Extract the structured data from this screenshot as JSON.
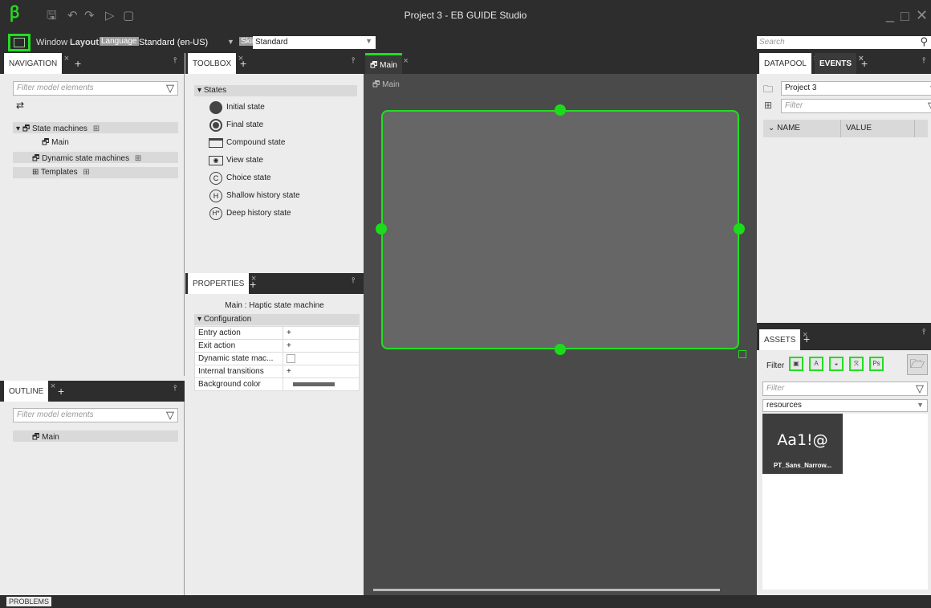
{
  "app": {
    "title": "Project 3 - EB GUIDE Studio"
  },
  "toolbar": {
    "window_label": "Window",
    "layout_label": "Layout",
    "language_tag": "Language",
    "language_value": "Standard (en-US)",
    "skin_tag": "Skin",
    "skin_value": "Standard",
    "search_placeholder": "Search"
  },
  "navigation": {
    "tab_label": "NAVIGATION",
    "filter_placeholder": "Filter model elements",
    "items": [
      {
        "label": "State machines"
      },
      {
        "label": "Main"
      },
      {
        "label": "Dynamic state machines"
      },
      {
        "label": "Templates"
      }
    ]
  },
  "toolbox": {
    "tab_label": "TOOLBOX",
    "section": "States",
    "items": [
      {
        "label": "Initial state",
        "icon": "initial-state-icon"
      },
      {
        "label": "Final state",
        "icon": "final-state-icon"
      },
      {
        "label": "Compound state",
        "icon": "compound-state-icon"
      },
      {
        "label": "View state",
        "icon": "view-state-icon"
      },
      {
        "label": "Choice state",
        "icon": "choice-state-icon"
      },
      {
        "label": "Shallow history state",
        "icon": "shallow-history-icon"
      },
      {
        "label": "Deep history state",
        "icon": "deep-history-icon"
      }
    ]
  },
  "properties": {
    "tab_label": "PROPERTIES",
    "subject": "Main : Haptic state machine",
    "section": "Configuration",
    "rows": [
      {
        "name": "Entry action",
        "value": "+"
      },
      {
        "name": "Exit action",
        "value": "+"
      },
      {
        "name": "Dynamic state mac...",
        "value": ""
      },
      {
        "name": "Internal transitions",
        "value": "+"
      },
      {
        "name": "Background color",
        "value": ""
      }
    ]
  },
  "outline": {
    "tab_label": "OUTLINE",
    "filter_placeholder": "Filter model elements",
    "items": [
      {
        "label": "Main"
      }
    ]
  },
  "editor": {
    "tab_label": "Main",
    "breadcrumb": "Main"
  },
  "datapool": {
    "tab_datapool": "DATAPOOL",
    "tab_events": "EVENTS",
    "project_value": "Project 3",
    "filter_placeholder": "Filter",
    "col_name": "NAME",
    "col_value": "VALUE"
  },
  "assets": {
    "tab_label": "ASSETS",
    "filter_label": "Filter",
    "filter_placeholder": "Filter",
    "folder_value": "resources",
    "card_preview": "Aa1!@",
    "card_name": "PT_Sans_Narrow..."
  },
  "status": {
    "problems_label": "PROBLEMS"
  },
  "colors": {
    "accent": "#22dd22",
    "chrome": "#2d2d2d",
    "canvas": "#4a4a4a",
    "state_fill": "#666666"
  }
}
